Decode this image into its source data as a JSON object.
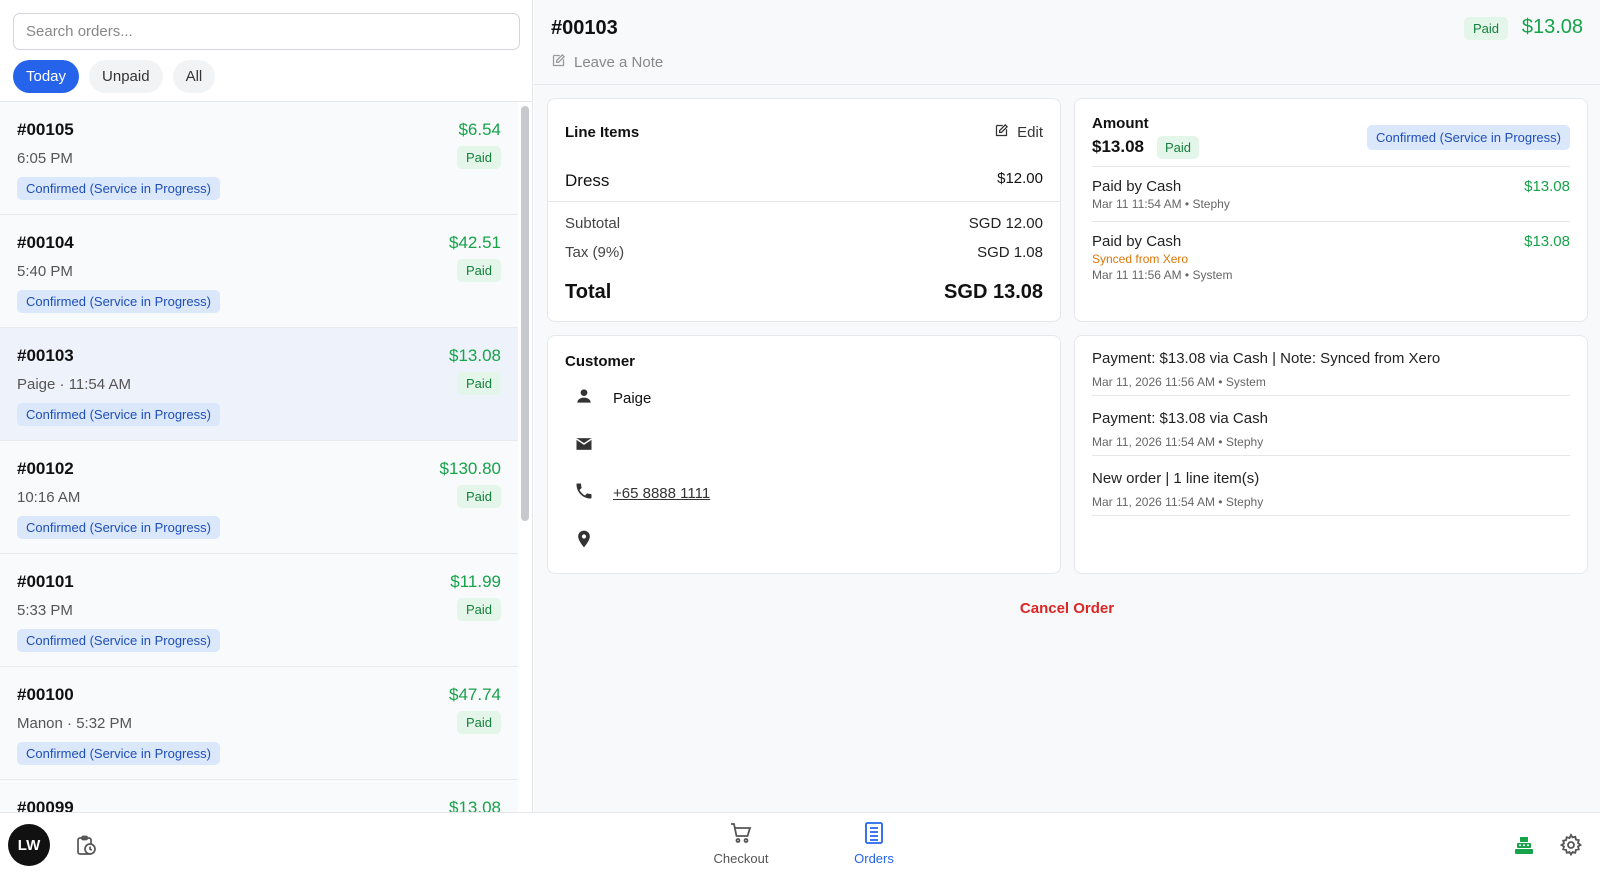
{
  "search": {
    "placeholder": "Search orders..."
  },
  "filters": [
    "Today",
    "Unpaid",
    "All"
  ],
  "orders": [
    {
      "number": "#00105",
      "amount": "$6.54",
      "meta": "6:05 PM",
      "payment": "Paid",
      "status": "Confirmed (Service in Progress)"
    },
    {
      "number": "#00104",
      "amount": "$42.51",
      "meta": "5:40 PM",
      "payment": "Paid",
      "status": "Confirmed (Service in Progress)"
    },
    {
      "number": "#00103",
      "amount": "$13.08",
      "meta": "Paige · 11:54 AM",
      "payment": "Paid",
      "status": "Confirmed (Service in Progress)"
    },
    {
      "number": "#00102",
      "amount": "$130.80",
      "meta": "10:16 AM",
      "payment": "Paid",
      "status": "Confirmed (Service in Progress)"
    },
    {
      "number": "#00101",
      "amount": "$11.99",
      "meta": "5:33 PM",
      "payment": "Paid",
      "status": "Confirmed (Service in Progress)"
    },
    {
      "number": "#00100",
      "amount": "$47.74",
      "meta": "Manon · 5:32 PM",
      "payment": "Paid",
      "status": "Confirmed (Service in Progress)"
    },
    {
      "number": "#00099",
      "amount": "$13.08",
      "meta": "",
      "payment": "",
      "status": ""
    }
  ],
  "header": {
    "title": "#00103",
    "note_label": "Leave a Note",
    "payment": "Paid",
    "total": "$13.08"
  },
  "line_items": {
    "heading": "Line Items",
    "edit_label": "Edit",
    "item_name": "Dress",
    "item_price": "$12.00",
    "subtotal_label": "Subtotal",
    "subtotal_value": "SGD 12.00",
    "tax_label": "Tax (9%)",
    "tax_value": "SGD 1.08",
    "total_label": "Total",
    "total_value": "SGD 13.08"
  },
  "amount": {
    "heading": "Amount",
    "value": "$13.08",
    "payment": "Paid",
    "status": "Confirmed (Service in Progress)",
    "payments": [
      {
        "label": "Paid by Cash",
        "amount": "$13.08",
        "sync": "",
        "sub": "Mar 11 11:54 AM • Stephy"
      },
      {
        "label": "Paid by Cash",
        "amount": "$13.08",
        "sync": "Synced from Xero",
        "sub": "Mar 11 11:56 AM • System"
      }
    ]
  },
  "customer": {
    "heading": "Customer",
    "name": "Paige",
    "email": "",
    "phone": "+65 8888 1111",
    "address": ""
  },
  "activity": [
    {
      "text": "Payment: $13.08 via Cash | Note: Synced from Xero",
      "sub": "Mar 11, 2026 11:56 AM • System"
    },
    {
      "text": "Payment: $13.08 via Cash",
      "sub": "Mar 11, 2026 11:54 AM • Stephy"
    },
    {
      "text": "New order | 1 line item(s)",
      "sub": "Mar 11, 2026 11:54 AM • Stephy"
    }
  ],
  "cancel_label": "Cancel Order",
  "bottom": {
    "avatar_initials": "LW",
    "nav_checkout": "Checkout",
    "nav_orders": "Orders"
  },
  "colors": {
    "accent": "#2563eb",
    "paid_green": "#16a34a",
    "danger": "#dc2626",
    "sync_orange": "#d97706"
  }
}
